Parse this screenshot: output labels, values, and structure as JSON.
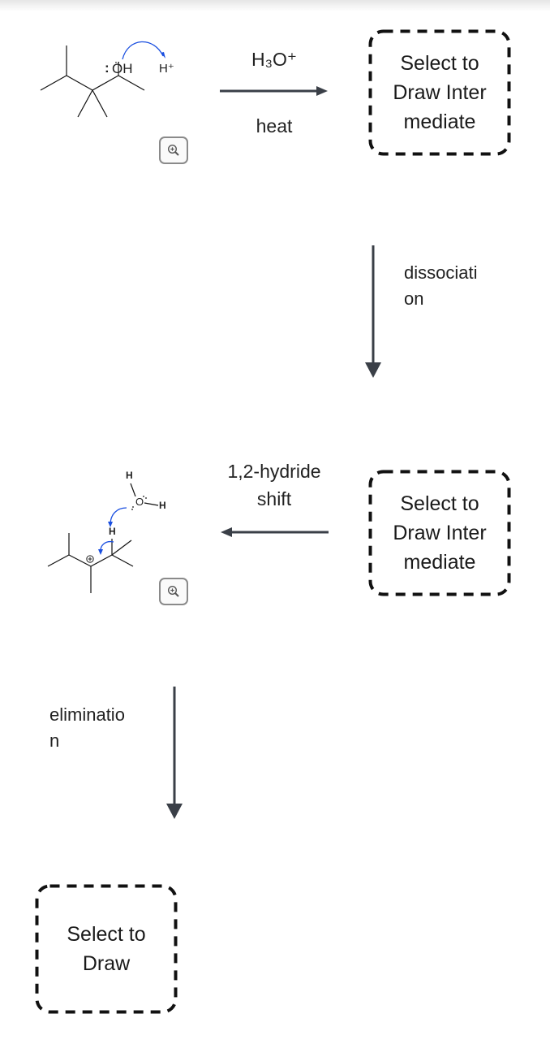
{
  "steps": {
    "step1": {
      "reagent_top": "H₃O⁺",
      "reagent_bottom": "heat",
      "arrow_direction": "right"
    },
    "step2": {
      "label": "dissociation",
      "label_lines": [
        "dissociati",
        "on"
      ],
      "arrow_direction": "down"
    },
    "step3": {
      "label_lines": [
        "1,2-hydride",
        "shift"
      ],
      "arrow_direction": "left"
    },
    "step4": {
      "label_lines": [
        "eliminatio",
        "n"
      ],
      "arrow_direction": "down"
    }
  },
  "molecules": {
    "reactant": {
      "atom_labels": {
        "oxygen": "ÖH",
        "lone_pair": ":",
        "proton": "H⁺"
      },
      "zoom_icon": "zoom-in-icon"
    },
    "carbocation": {
      "atom_labels": {
        "water_o": "O",
        "water_h1": "H",
        "water_h2": "H",
        "migrating_h": "H",
        "charge": "+"
      },
      "zoom_icon": "zoom-in-icon"
    }
  },
  "drop_boxes": [
    {
      "lines": [
        "Select to",
        "Draw Inter",
        "mediate"
      ]
    },
    {
      "lines": [
        "Select to",
        "Draw Inter",
        "mediate"
      ]
    },
    {
      "lines": [
        "Select to",
        "Draw"
      ]
    }
  ],
  "colors": {
    "arrow": "#3a3f47",
    "curved_arrow": "#1a4fe0",
    "bond": "#111111",
    "box_border": "#111111",
    "zoom_border": "#8a8a8a"
  }
}
